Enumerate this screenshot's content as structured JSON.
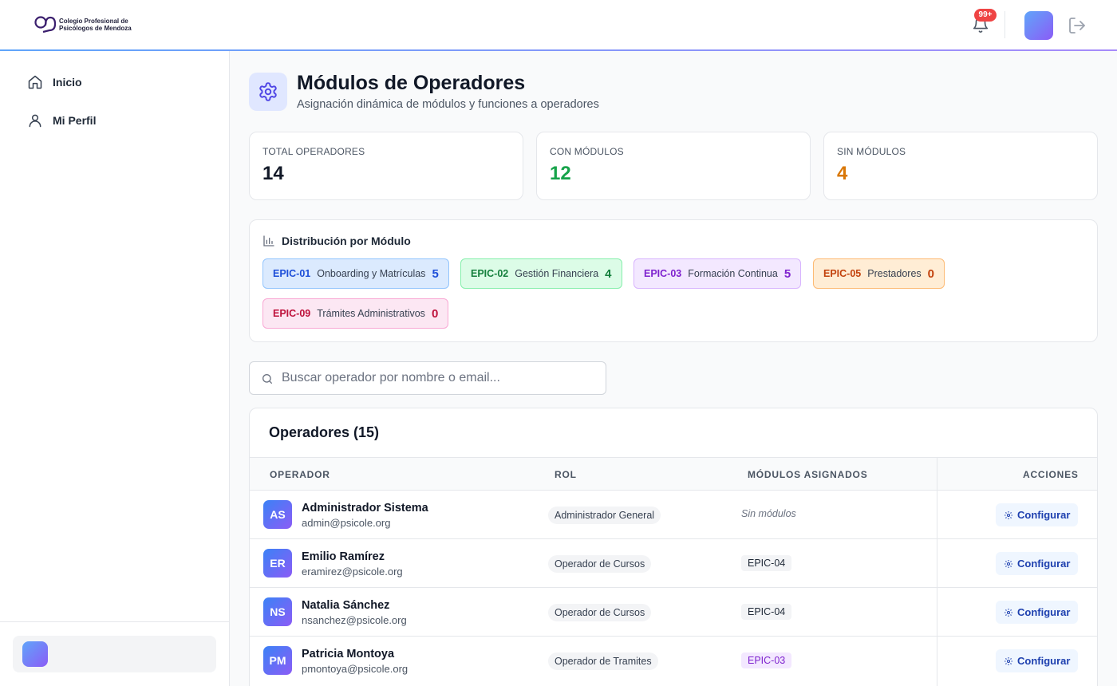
{
  "header": {
    "logo_line1": "Colegio Profesional de",
    "logo_line2": "Psicólogos de Mendoza",
    "notification_badge": "99+"
  },
  "sidebar": {
    "items": [
      {
        "label": "Inicio",
        "icon": "home-icon"
      },
      {
        "label": "Mi Perfil",
        "icon": "user-icon"
      }
    ]
  },
  "page": {
    "title": "Módulos de Operadores",
    "subtitle": "Asignación dinámica de módulos y funciones a operadores"
  },
  "stats": [
    {
      "label": "TOTAL OPERADORES",
      "value": "14",
      "color": "#111827"
    },
    {
      "label": "CON MÓDULOS",
      "value": "12",
      "color": "#16a34a"
    },
    {
      "label": "SIN MÓDULOS",
      "value": "4",
      "color": "#d97706"
    }
  ],
  "distribution": {
    "title": "Distribución por Módulo",
    "chips": [
      {
        "code": "EPIC-01",
        "name": "Onboarding y Matrículas",
        "count": "5",
        "accent": "#1d4ed8",
        "bg": "#dbeafe",
        "border": "#93c5fd"
      },
      {
        "code": "EPIC-02",
        "name": "Gestión Financiera",
        "count": "4",
        "accent": "#15803d",
        "bg": "#dcfce7",
        "border": "#86efac"
      },
      {
        "code": "EPIC-03",
        "name": "Formación Continua",
        "count": "5",
        "accent": "#7e22ce",
        "bg": "#f3e8ff",
        "border": "#d8b4fe"
      },
      {
        "code": "EPIC-05",
        "name": "Prestadores",
        "count": "0",
        "accent": "#c2410c",
        "bg": "#ffedd5",
        "border": "#fdba74"
      },
      {
        "code": "EPIC-09",
        "name": "Trámites Administrativos",
        "count": "0",
        "accent": "#be123c",
        "bg": "#fce7f3",
        "border": "#f9a8d4"
      }
    ]
  },
  "search": {
    "placeholder": "Buscar operador por nombre o email...",
    "value": ""
  },
  "table": {
    "title": "Operadores (15)",
    "columns": [
      "OPERADOR",
      "ROL",
      "MÓDULOS ASIGNADOS",
      "ACCIONES"
    ],
    "action_label": "Configurar",
    "empty_modules_label": "Sin módulos",
    "rows": [
      {
        "initials": "AS",
        "name": "Administrador Sistema",
        "email": "admin@psicole.org",
        "role": "Administrador General",
        "module": "",
        "module_bg": "",
        "module_color": ""
      },
      {
        "initials": "ER",
        "name": "Emilio Ramírez",
        "email": "eramirez@psicole.org",
        "role": "Operador de Cursos",
        "module": "EPIC-04",
        "module_bg": "#f3f4f6",
        "module_color": "#1f2937"
      },
      {
        "initials": "NS",
        "name": "Natalia Sánchez",
        "email": "nsanchez@psicole.org",
        "role": "Operador de Cursos",
        "module": "EPIC-04",
        "module_bg": "#f3f4f6",
        "module_color": "#1f2937"
      },
      {
        "initials": "PM",
        "name": "Patricia Montoya",
        "email": "pmontoya@psicole.org",
        "role": "Operador de Tramites",
        "module": "EPIC-03",
        "module_bg": "#f3e8ff",
        "module_color": "#7e22ce"
      }
    ]
  }
}
